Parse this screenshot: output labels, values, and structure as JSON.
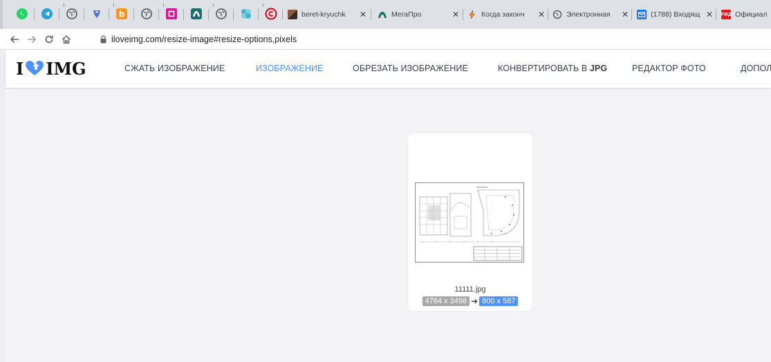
{
  "browser": {
    "pinned_tabs": [
      {
        "icon": "whatsapp-icon",
        "color": "#25d366"
      },
      {
        "icon": "telegram-icon",
        "color": "#2a9fd6"
      },
      {
        "icon": "globe-icon",
        "color": "#5f6368"
      },
      {
        "icon": "shield-icon",
        "color": "#4a6dd8"
      },
      {
        "icon": "bookmark-icon",
        "color": "#f7931e"
      },
      {
        "icon": "globe-icon",
        "color": "#5f6368"
      },
      {
        "icon": "square-icon",
        "color": "#d4179a"
      },
      {
        "icon": "megapro-icon",
        "color": "#1e6e6e"
      },
      {
        "icon": "globe-icon",
        "color": "#5f6368"
      },
      {
        "icon": "crystal-icon",
        "color": "#46b5c9"
      },
      {
        "icon": "copyright-icon",
        "color": "#d0021b"
      }
    ],
    "tabs": [
      {
        "title": "beret-kryuchk",
        "icon": "image-icon",
        "color": "#5a3a2e"
      },
      {
        "title": "МегаПро",
        "icon": "megapro-icon",
        "color": "#1e6e6e"
      },
      {
        "title": "Когда законч",
        "icon": "lightning-icon",
        "color": "#f2b01e"
      },
      {
        "title": "Электронная",
        "icon": "globe-icon",
        "color": "#5f6368"
      },
      {
        "title": "(1788) Входящ",
        "icon": "mail-icon",
        "color": "#1a73e8"
      },
      {
        "title": "Официал",
        "icon": "rzd-icon",
        "color": "#e21a1a"
      }
    ],
    "url": "iloveimg.com/resize-image#resize-options,pixels"
  },
  "site": {
    "logo_left": "I",
    "logo_right": "IMG",
    "nav": [
      "СЖАТЬ ИЗОБРАЖЕНИЕ",
      "ИЗОБРАЖЕНИЕ",
      "ОБРЕЗАТЬ ИЗОБРАЖЕНИЕ",
      "КОНВЕРТИРОВАТЬ В",
      "JPG",
      "РЕДАКТОР ФОТО",
      "ДОПОЛ"
    ]
  },
  "file": {
    "name": "11111.jpg",
    "original_size": "4764 x 3498",
    "new_size": "800 x 587"
  },
  "colors": {
    "accent": "#4d90fe",
    "badge_grey": "#a8a8a8"
  }
}
